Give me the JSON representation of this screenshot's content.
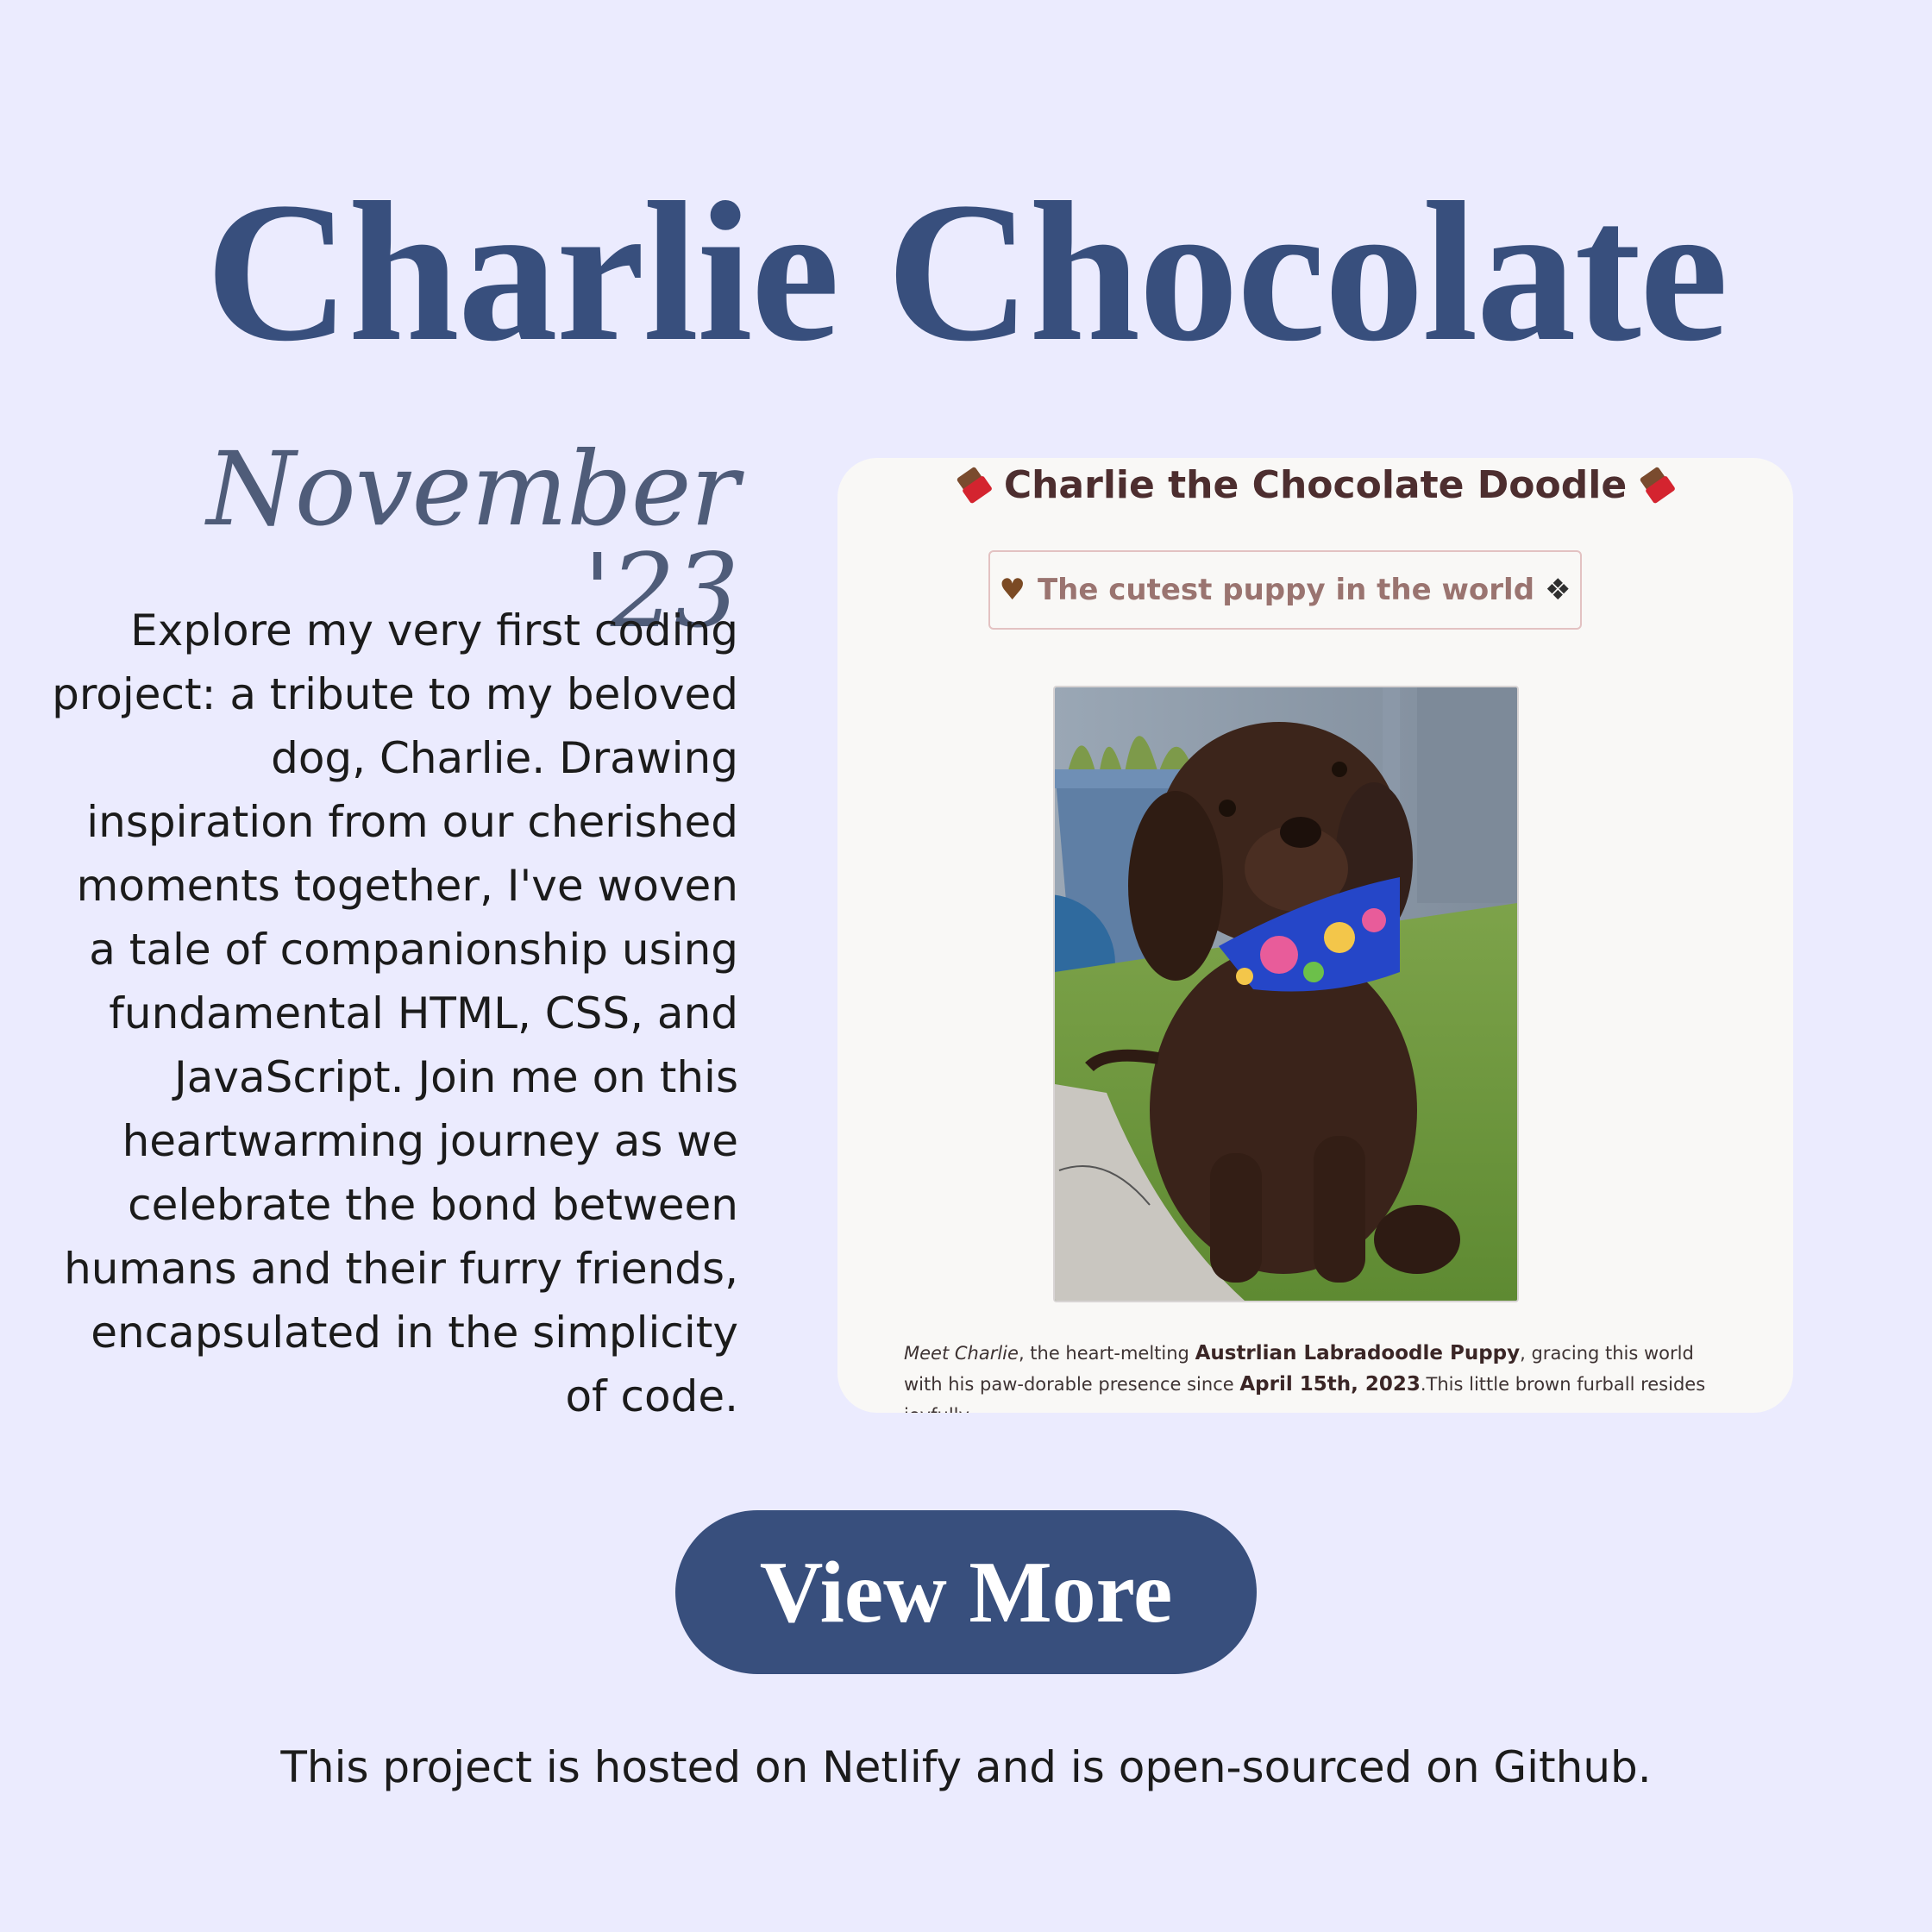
{
  "title": "Charlie Chocolate",
  "date_label": "November '23",
  "description": "Explore my very first coding project: a tribute to my beloved dog, Charlie. Drawing inspiration from our cherished moments together, I've woven a tale of companionship using fundamental HTML, CSS, and JavaScript. Join me on this heartwarming journey as we celebrate the bond between humans and their furry friends, encapsulated in the simplicity of code.",
  "preview": {
    "header": "Charlie the Chocolate Doodle",
    "header_icon": "chocolate-bar-icon",
    "tagline": "The cutest puppy in the world",
    "tagline_icons": [
      "brown-heart-icon",
      "paw-prints-icon"
    ],
    "photo_alt": "Charlie the chocolate labradoodle puppy",
    "paragraph": {
      "lead_italic": "Meet Charlie",
      "part1": ", the heart-melting ",
      "breed": "Austrlian Labradoodle Puppy",
      "part2": ", gracing this world with his paw-dorable presence since ",
      "birthdate": "April 15th, 2023",
      "part3": ".This little brown furball resides joyfully"
    }
  },
  "view_more_label": "View More",
  "footer": "This project is hosted on Netlify and is open-sourced on Github.",
  "colors": {
    "background": "#ebebfe",
    "accent": "#384f7d",
    "card": "#f9f8f6",
    "site_header": "#4d2e2f",
    "tagline": "#9a7470"
  }
}
